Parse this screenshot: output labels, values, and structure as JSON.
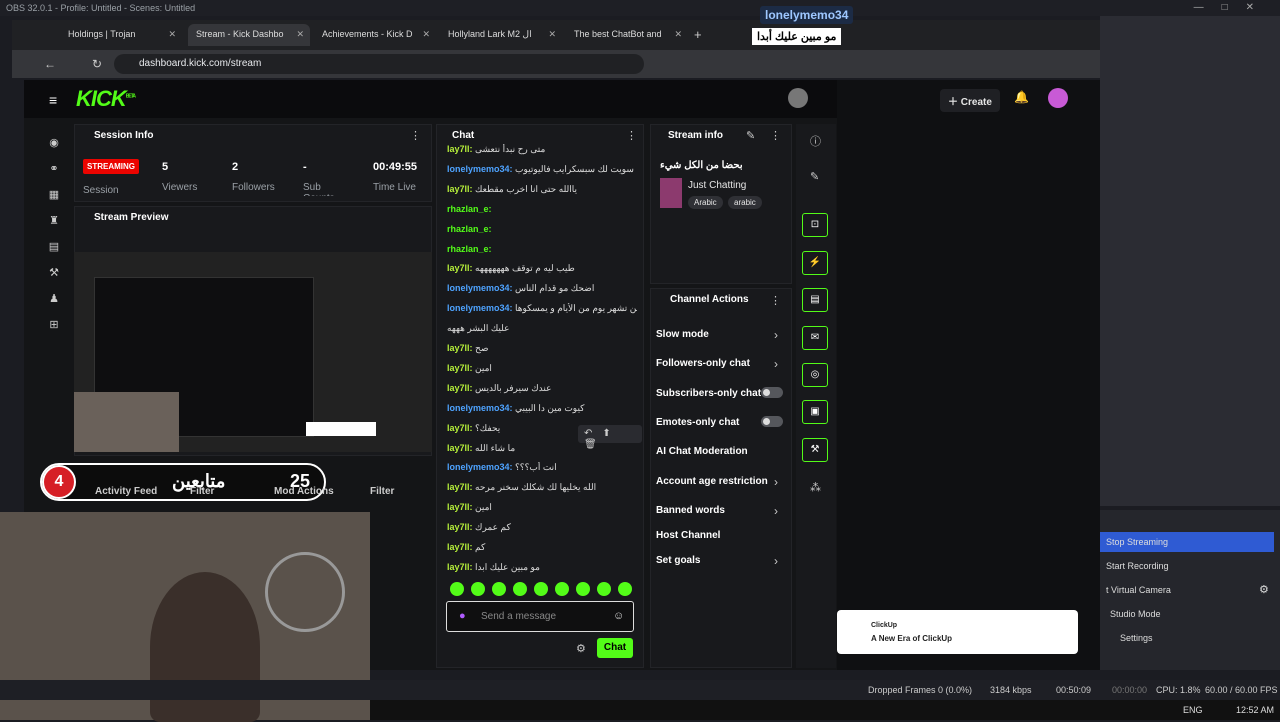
{
  "obs_title": "OBS 32.0.1 - Profile: Untitled - Scenes: Untitled",
  "overlay": {
    "username": "lonelymemo34",
    "message": "مو مبين عليك أبدا"
  },
  "browser": {
    "tabs": [
      {
        "label": "Holdings | Trojan"
      },
      {
        "label": "Stream - Kick Dashbo"
      },
      {
        "label": "Achievements - Kick D"
      },
      {
        "label": "Hollyland Lark M2 ال"
      },
      {
        "label": "The best ChatBot and"
      }
    ],
    "url": "dashboard.kick.com/stream"
  },
  "kick": {
    "logo": "KICK",
    "logo_sup": "BETA",
    "create_label": "Create",
    "session": {
      "title": "Session Info",
      "streaming_label": "STREAMING",
      "session_label": "Session",
      "viewers_value": "5",
      "viewers_label": "Viewers",
      "followers_value": "2",
      "followers_label": "Followers",
      "subs_value": "-",
      "subs_label": "Sub Counts",
      "time_value": "00:49:55",
      "time_label": "Time Live"
    },
    "preview_title": "Stream Preview",
    "activity_label": "Activity Feed",
    "filter_label": "Filter",
    "mod_actions_label": "Mod Actions",
    "filter2_label": "Filter",
    "chat": {
      "title": "Chat",
      "placeholder": "Send a message",
      "send_label": "Chat",
      "messages": [
        {
          "user": "lay7ll",
          "text": "متى رح نبدأ نتعشى",
          "cls": "u2"
        },
        {
          "user": "lonelymemo34",
          "text": "سويت لك سبسكرايب فاليوتيوب",
          "cls": "u1"
        },
        {
          "user": "lay7ll",
          "text": "ياالله حتى انا اخرب مقطعك",
          "cls": "u2"
        },
        {
          "user": "rhazlan_e",
          "text": "",
          "cls": "u3"
        },
        {
          "user": "rhazlan_e",
          "text": "",
          "cls": "u3"
        },
        {
          "user": "rhazlan_e",
          "text": "",
          "cls": "u3"
        },
        {
          "user": "lay7ll",
          "text": "طيب ليه م توقف هههههههه",
          "cls": "u2"
        },
        {
          "user": "lonelymemo34",
          "text": "اضحك مو قدام الناس",
          "cls": "u1"
        },
        {
          "user": "lonelymemo34",
          "text": "يمكن تشهر يوم من الأيام و يمسكوها",
          "cls": "u1"
        },
        {
          "user": "",
          "text": "عليك البشر هههه",
          "cls": "u1"
        },
        {
          "user": "lay7ll",
          "text": "صح",
          "cls": "u2"
        },
        {
          "user": "lay7ll",
          "text": "امين",
          "cls": "u2"
        },
        {
          "user": "lay7ll",
          "text": "عندك سيرفر بالديس",
          "cls": "u2"
        },
        {
          "user": "lonelymemo34",
          "text": "كيوت مين دا البيبي",
          "cls": "u1"
        },
        {
          "user": "lay7ll",
          "text": "يحفك؟",
          "cls": "u2"
        },
        {
          "user": "lay7ll",
          "text": "ما شاء الله",
          "cls": "u2"
        },
        {
          "user": "lonelymemo34",
          "text": "انت أب؟؟؟",
          "cls": "u1"
        },
        {
          "user": "lay7ll",
          "text": "الله يخليها لك شكلك سخنر مرحه",
          "cls": "u2"
        },
        {
          "user": "lay7ll",
          "text": "امين",
          "cls": "u2"
        },
        {
          "user": "lay7ll",
          "text": "كم عمرك",
          "cls": "u2"
        },
        {
          "user": "lay7ll",
          "text": "كم",
          "cls": "u2"
        },
        {
          "user": "lay7ll",
          "text": "مو مبين عليك ابدا",
          "cls": "u2"
        }
      ]
    },
    "stream_info": {
      "title": "Stream info",
      "stream_title": "بحضا من الكل شيء",
      "category": "Just Chatting",
      "tags": [
        "Arabic",
        "arabic"
      ]
    },
    "channel_actions": {
      "title": "Channel Actions",
      "items": [
        "Slow mode",
        "Followers-only chat",
        "Subscribers-only chat",
        "Emotes-only chat",
        "AI Chat Moderation",
        "Account age restriction",
        "Banned words",
        "Host Channel",
        "Set goals"
      ]
    }
  },
  "obs": {
    "buttons": [
      "Stop Streaming",
      "Start Recording",
      "t Virtual Camera",
      "Studio Mode",
      "Settings"
    ],
    "ad_title": "ClickUp",
    "ad_text": "A New Era of ClickUp",
    "status": {
      "dropped": "Dropped Frames 0 (0.0%)",
      "kbps": "3184 kbps",
      "stream_time": "00:50:09",
      "rec_time": "00:00:00",
      "cpu": "CPU: 1.8%",
      "fps": "60.00 / 60.00 FPS"
    }
  },
  "stream_overlay": {
    "count_left": "4",
    "label": "متابعين",
    "count_right": "25"
  },
  "taskbar": {
    "lang": "ENG",
    "time": "12:52 AM"
  }
}
